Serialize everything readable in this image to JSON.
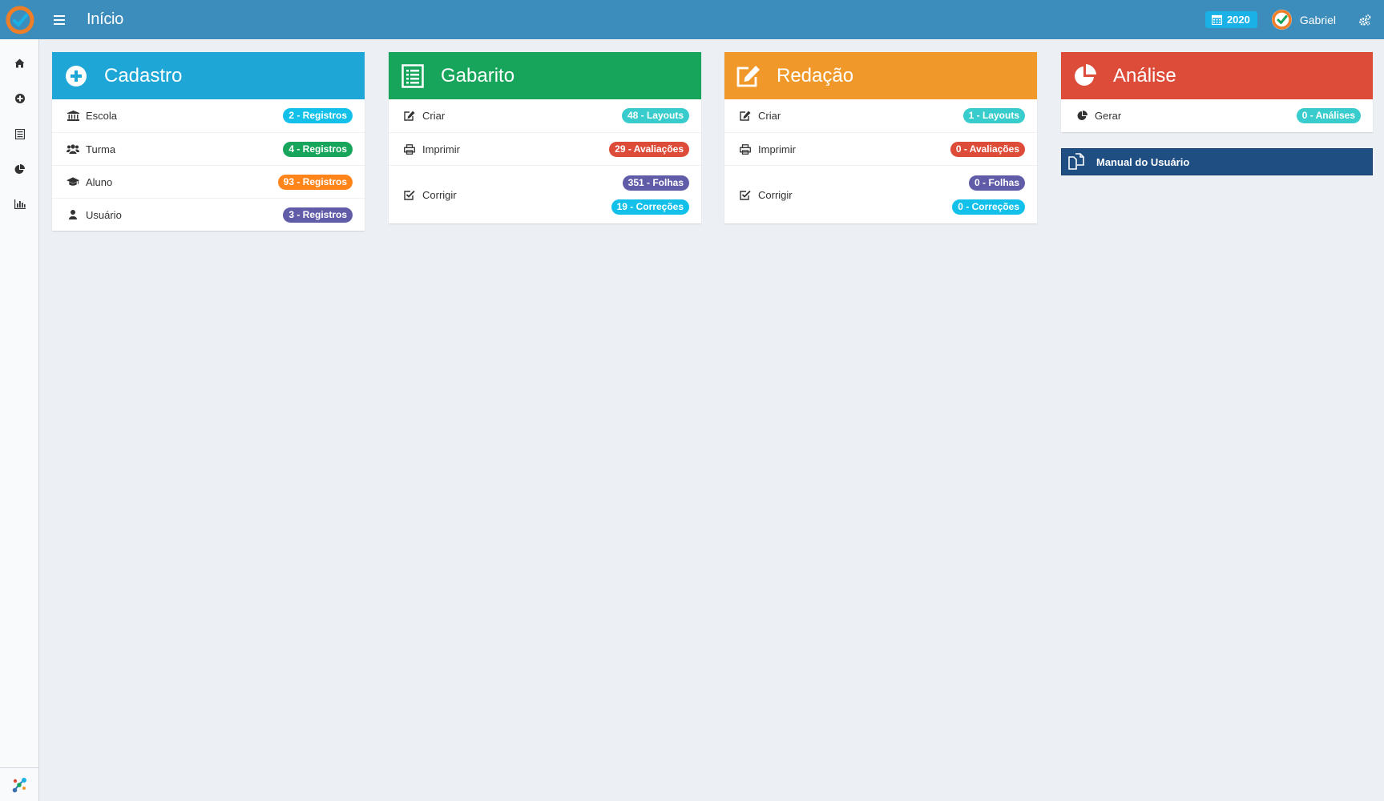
{
  "header": {
    "title": "Início",
    "year": "2020",
    "user_name": "Gabriel"
  },
  "colors": {
    "topbar": "#3c8dbc",
    "cadastro": "#1ea7d6",
    "gabarito": "#17a55c",
    "redacao": "#f0992a",
    "analise": "#dd4b39",
    "manual": "#1f4f82",
    "badge_teal": "#39cccc",
    "badge_aqua": "#12c0ea",
    "badge_green": "#17a55c",
    "badge_orange": "#ff851b",
    "badge_purple": "#605ca8",
    "badge_red": "#dd4b39"
  },
  "sidebar": {
    "items": [
      {
        "icon": "home-icon"
      },
      {
        "icon": "plus-circle-icon"
      },
      {
        "icon": "list-icon"
      },
      {
        "icon": "pie-chart-icon"
      },
      {
        "icon": "bar-chart-icon"
      }
    ]
  },
  "cards": {
    "cadastro": {
      "title": "Cadastro",
      "rows": [
        {
          "label": "Escola",
          "badge": "2 - Registros"
        },
        {
          "label": "Turma",
          "badge": "4 - Registros"
        },
        {
          "label": "Aluno",
          "badge": "93 - Registros"
        },
        {
          "label": "Usuário",
          "badge": "3 - Registros"
        }
      ]
    },
    "gabarito": {
      "title": "Gabarito",
      "rows": [
        {
          "label": "Criar",
          "badge": "48 - Layouts"
        },
        {
          "label": "Imprimir",
          "badge": "29 - Avaliações"
        },
        {
          "label": "Corrigir",
          "badge": "351 - Folhas",
          "badge2": "19 - Correções"
        }
      ]
    },
    "redacao": {
      "title": "Redação",
      "rows": [
        {
          "label": "Criar",
          "badge": "1 - Layouts"
        },
        {
          "label": "Imprimir",
          "badge": "0 - Avaliações"
        },
        {
          "label": "Corrigir",
          "badge": "0 - Folhas",
          "badge2": "0 - Correções"
        }
      ]
    },
    "analise": {
      "title": "Análise",
      "rows": [
        {
          "label": "Gerar",
          "badge": "0 - Análises"
        }
      ]
    }
  },
  "manual": {
    "label": "Manual do Usuário"
  }
}
